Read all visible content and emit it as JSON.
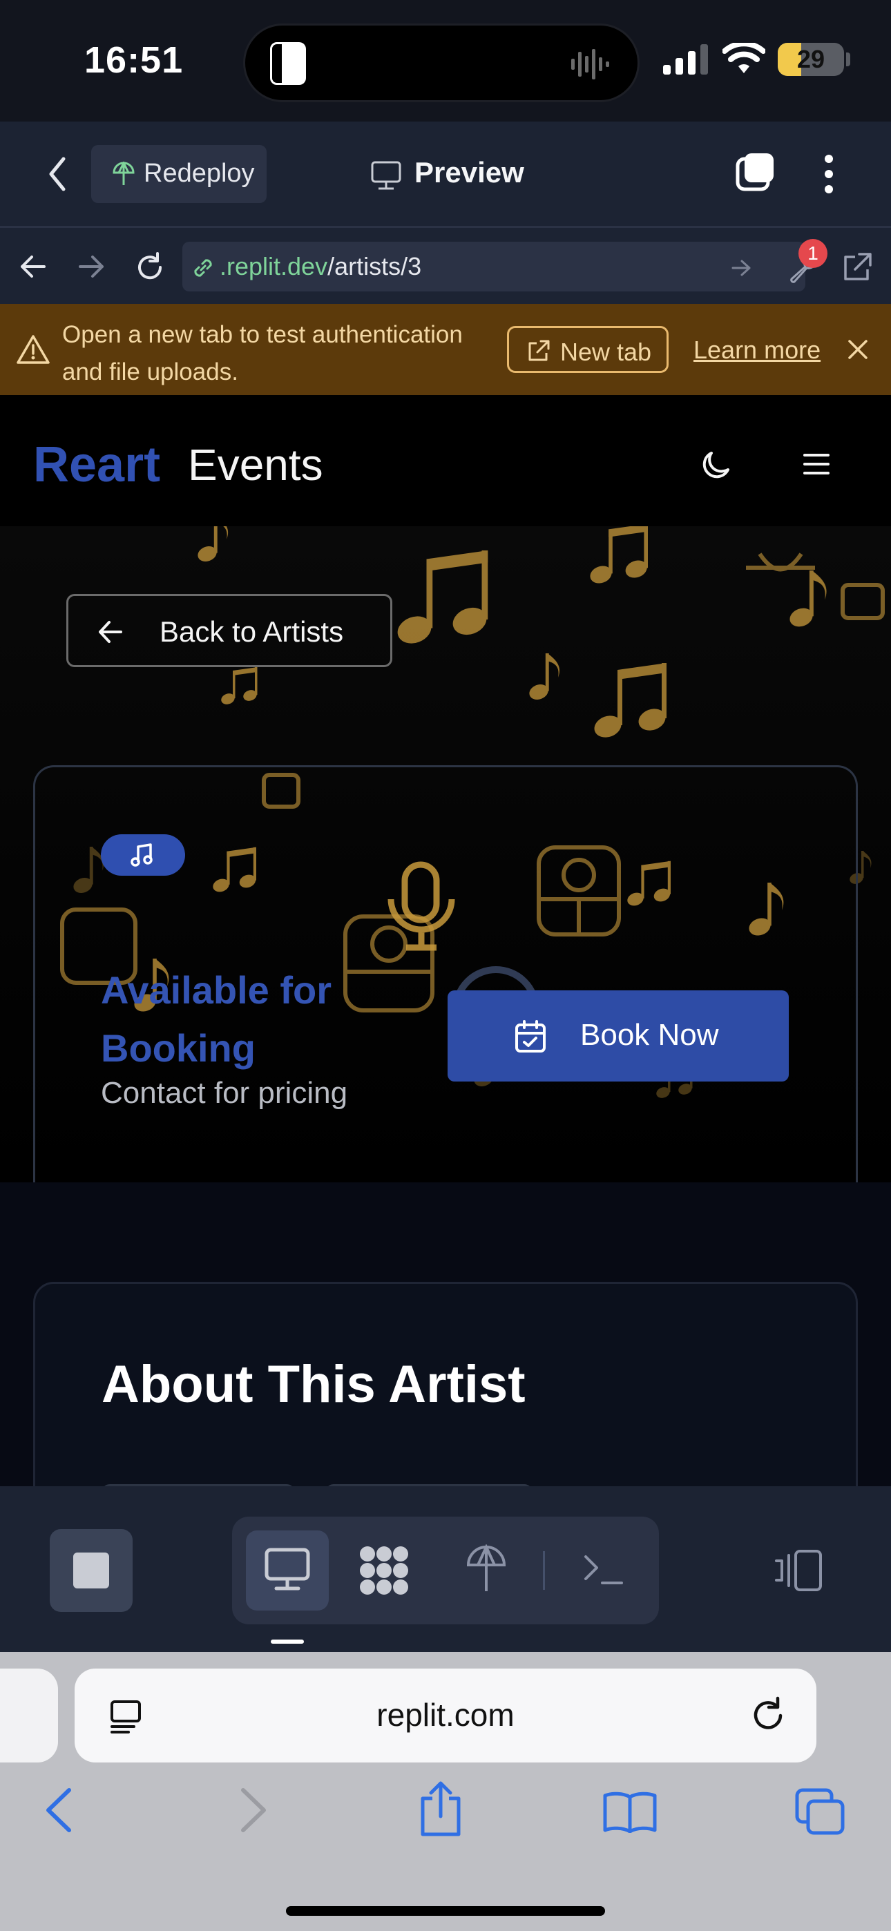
{
  "status_bar": {
    "time": "16:51",
    "battery": "29"
  },
  "replit_header": {
    "redeploy_label": "Redeploy",
    "preview_label": "Preview"
  },
  "url_bar": {
    "host": ".replit.dev",
    "path": "/artists/3",
    "badge_count": "1"
  },
  "banner": {
    "message": "Open a new tab to test authentication and file uploads.",
    "new_tab_label": "New tab",
    "learn_more_label": "Learn more"
  },
  "site": {
    "brand_primary": "Reart",
    "brand_secondary": "Events",
    "back_label": "Back to Artists",
    "availability": "Available for Booking",
    "pricing": "Contact for pricing",
    "book_label": "Book Now",
    "about_title": "About This Artist"
  },
  "safari": {
    "url": "replit.com"
  },
  "colors": {
    "brand_blue": "#3151b3",
    "button_blue": "#2e4ca6",
    "warning_bg": "#5c3a0b",
    "note_gold": "#c89a3c"
  }
}
